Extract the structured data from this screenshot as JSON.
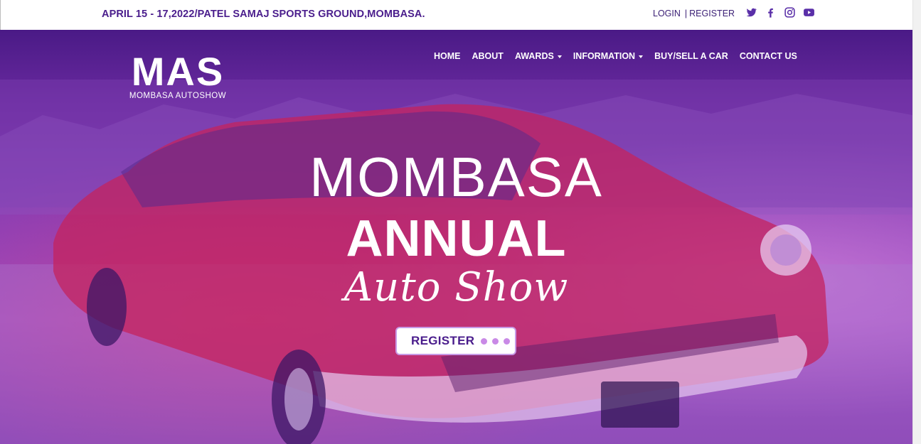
{
  "topbar": {
    "event_info": "APRIL 15 - 17,2022/PATEL SAMAJ SPORTS GROUND,MOMBASA.",
    "login": "LOGIN",
    "separator": "|",
    "register": "REGISTER",
    "social_icons": [
      "twitter-icon",
      "facebook-icon",
      "instagram-icon",
      "youtube-icon"
    ],
    "accent_color": "#4a1d8c"
  },
  "logo": {
    "letters": "MAS",
    "tagline": "MOMBASA AUTOSHOW"
  },
  "nav": {
    "items": [
      {
        "label": "HOME",
        "dropdown": false
      },
      {
        "label": "ABOUT",
        "dropdown": false
      },
      {
        "label": "AWARDS",
        "dropdown": true
      },
      {
        "label": "INFORMATION",
        "dropdown": true
      },
      {
        "label": "BUY/SELL A CAR",
        "dropdown": false
      },
      {
        "label": "CONTACT US",
        "dropdown": false
      }
    ]
  },
  "hero": {
    "line1": "MOMBASA",
    "line2": "ANNUAL",
    "line3": "Auto Show",
    "cta_label": "REGISTER",
    "overlay_color": "#7a34ad"
  }
}
